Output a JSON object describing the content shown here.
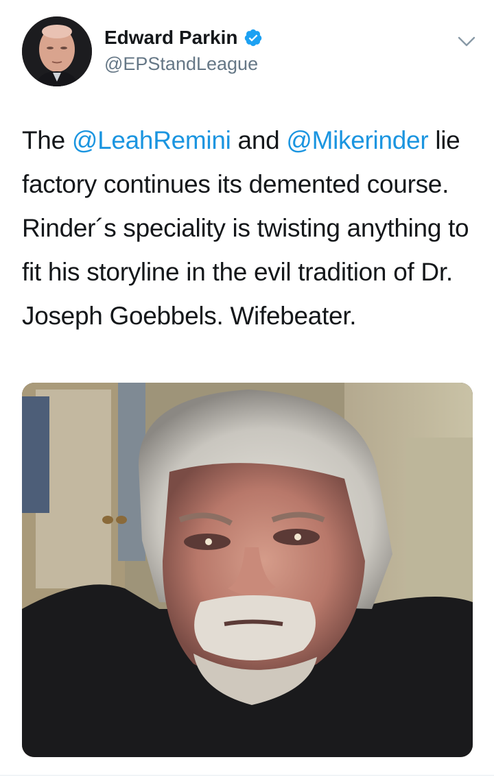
{
  "author": {
    "display_name": "Edward Parkin",
    "handle": "@EPStandLeague",
    "verified": true
  },
  "tweet": {
    "text_parts": [
      {
        "text": "The ",
        "type": "text"
      },
      {
        "text": "@LeahRemini",
        "type": "mention"
      },
      {
        "text": " and ",
        "type": "text"
      },
      {
        "text": "@Mikerinder",
        "type": "mention"
      },
      {
        "text": " lie factory continues its demented course. Rinder´s speciality is twisting anything to fit his storyline in the evil tradition of Dr. Joseph Goebbels. Wifebeater.",
        "type": "text"
      }
    ]
  },
  "icons": {
    "verified": "verified-badge-icon",
    "menu": "chevron-down-icon"
  },
  "colors": {
    "mention": "#1b95e0",
    "verified": "#1da1f2",
    "secondary_text": "#657786"
  }
}
